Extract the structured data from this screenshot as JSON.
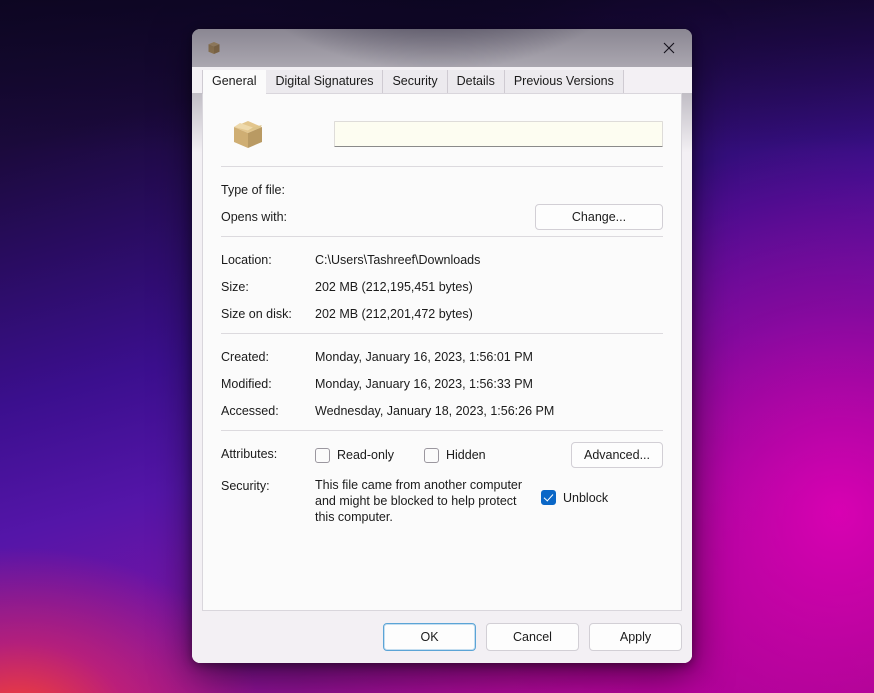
{
  "window": {
    "title": "",
    "title_icon": "archive-box-icon",
    "close_label": "✕"
  },
  "tabs": [
    {
      "label": "General",
      "active": true
    },
    {
      "label": "Digital Signatures",
      "active": false
    },
    {
      "label": "Security",
      "active": false
    },
    {
      "label": "Details",
      "active": false
    },
    {
      "label": "Previous Versions",
      "active": false
    }
  ],
  "general": {
    "file_icon": "archive-box-icon",
    "filename_value": "",
    "filename_placeholder": "",
    "type_of_file": {
      "label": "Type of file:",
      "value": ""
    },
    "opens_with": {
      "label": "Opens with:",
      "value": "",
      "change_button": "Change..."
    },
    "location": {
      "label": "Location:",
      "value": "C:\\Users\\Tashreef\\Downloads"
    },
    "size": {
      "label": "Size:",
      "value": "202 MB (212,195,451 bytes)"
    },
    "size_on_disk": {
      "label": "Size on disk:",
      "value": "202 MB (212,201,472 bytes)"
    },
    "created": {
      "label": "Created:",
      "value": "Monday, January 16, 2023, 1:56:01 PM"
    },
    "modified": {
      "label": "Modified:",
      "value": "Monday, January 16, 2023, 1:56:33 PM"
    },
    "accessed": {
      "label": "Accessed:",
      "value": "Wednesday, January 18, 2023, 1:56:26 PM"
    },
    "attributes": {
      "label": "Attributes:",
      "read_only": {
        "label": "Read-only",
        "checked": false
      },
      "hidden": {
        "label": "Hidden",
        "checked": false
      },
      "advanced_button": "Advanced..."
    },
    "security": {
      "label": "Security:",
      "message": "This file came from another computer and might be blocked to help protect this computer.",
      "unblock": {
        "label": "Unblock",
        "checked": true
      }
    }
  },
  "footer": {
    "ok": "OK",
    "cancel": "Cancel",
    "apply": "Apply"
  },
  "colors": {
    "accent_blue": "#0a67c7",
    "default_button_border": "#5ba4d6",
    "dialog_bg": "#f3f0f4",
    "panel_bg": "#fbfbfb",
    "name_field_bg": "#fdfdf1"
  }
}
